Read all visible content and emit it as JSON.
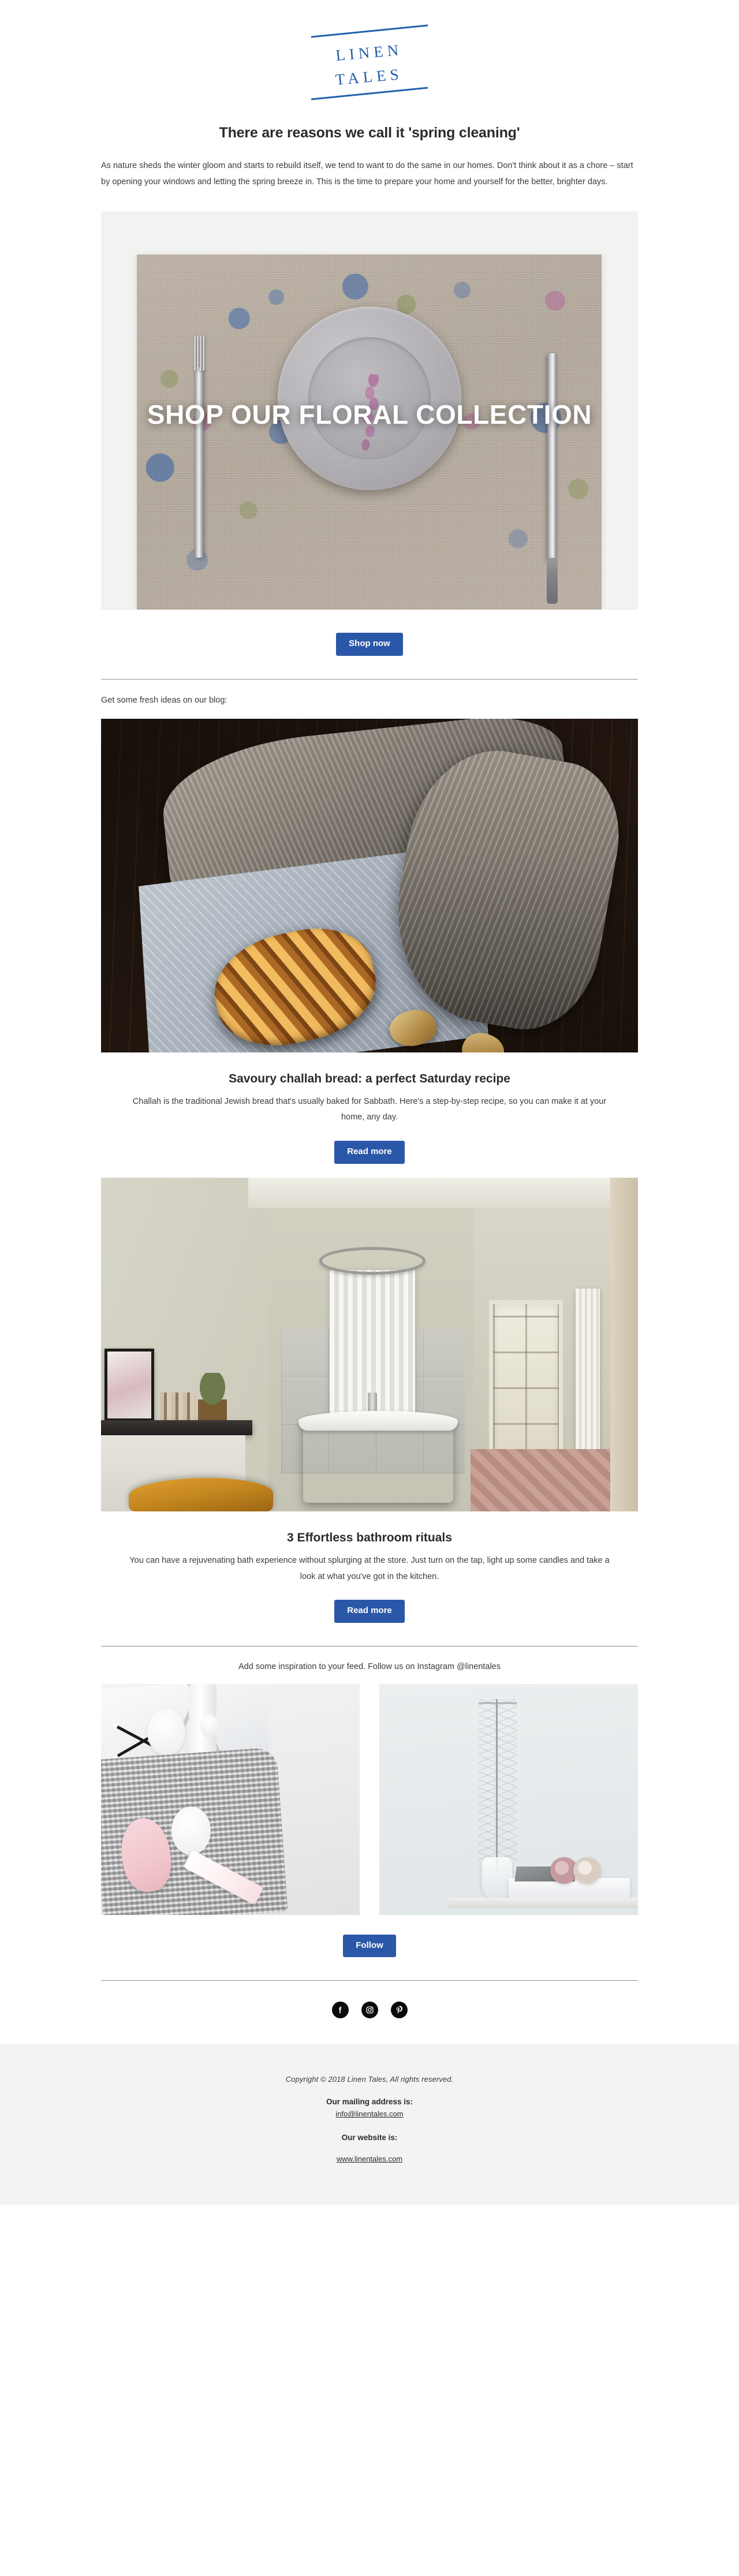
{
  "brand": {
    "logo_line1": "LINEN",
    "logo_line2": "TALES",
    "logo_color": "#2460ab"
  },
  "header": {
    "headline": "There are reasons we call it 'spring cleaning'",
    "intro": "As nature sheds the winter gloom and starts to rebuild itself, we tend to want to do the same in our homes. Don't think about it as a chore – start by opening your windows and letting the spring breeze in. This is the time to prepare your home and yourself for the better, brighter days."
  },
  "hero": {
    "overlay_text": "SHOP OUR FLORAL COLLECTION",
    "image_alt": "floral linen placemat with gray plate, fork and knife",
    "cta_label": "Shop now"
  },
  "blog": {
    "lead": "Get some fresh ideas on our blog:",
    "articles": [
      {
        "image_alt": "braided challah bread on parchment paper with linen towel on dark wood table",
        "title": "Savoury challah bread: a perfect Saturday recipe",
        "body": "Challah is the traditional Jewish bread that's usually baked for Sabbath. Here's a step-by-step recipe, so you can make it at your home, any day.",
        "cta_label": "Read more"
      },
      {
        "image_alt": "sage green bathroom with copper clawfoot bathtub and white shower curtain",
        "title": "3 Effortless bathroom rituals",
        "body": "You can have a rejuvenating bath experience without splurging at the store. Just turn on the tap, light up some candles and take a look at what you've got in the kitchen.",
        "cta_label": "Read more"
      }
    ]
  },
  "instagram": {
    "lead": "Add some inspiration to your feed. Follow us on Instagram @linentales",
    "photos": [
      {
        "alt": "skincare items and cotton pads on gray waffle linen towel"
      },
      {
        "alt": "dried branch in glass vase with rolled linen towels on a book"
      }
    ],
    "cta_label": "Follow"
  },
  "social": {
    "items": [
      {
        "name": "facebook",
        "icon": "facebook-icon"
      },
      {
        "name": "instagram",
        "icon": "instagram-icon"
      },
      {
        "name": "pinterest",
        "icon": "pinterest-icon"
      }
    ]
  },
  "footer": {
    "copyright": "Copyright © 2018 Linen Tales, All rights reserved.",
    "mailing_label": "Our mailing address is:",
    "email": "info@linentales.com",
    "website_label": "Our website is:",
    "website": "www.linentales.com",
    "background": "#f4f3f1"
  },
  "theme": {
    "button_color": "#2b57a8",
    "text_color": "#3b3b3b",
    "heading_color": "#2b2b2b"
  }
}
